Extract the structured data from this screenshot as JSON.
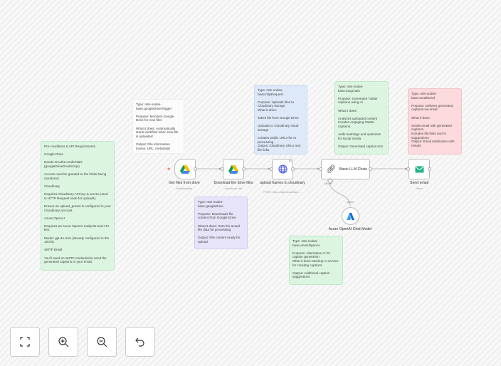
{
  "notes": {
    "prereq": "Pre-conditions & API Requirements\n\nGoogle Drive\n\nNeeds OAuth2 credentials (googleDriveOAuth2Api)\n\nAccess must be granted to the folder being monitored.\n\nCloudinary\n\nRequires Cloudinary API key & secret (used in HTTP Request node for uploads).\n\nEnsure an upload_preset is configured in your Cloudinary account.\n\nAzure OpenAI\n\nRequires an Azure OpenAI endpoint and API key.\n\nModel: gpt-4o-mini (already configured in the JSON).\n\nSMTP Email\n\nYou'll need an SMTP credential to send the generated captions to your email.",
    "trigger": "Type: n8n-nodes-base.googleDriveTrigger\n\nPurpose: Monitors Google Drive for new files\n\nWhat it does: Automatically starts workflow when new file is uploaded\n\nOutput: File information (name, URL, metadata)",
    "http": "Type: n8n-nodes-base.httpRequest\n\nPurpose: Uploads files to Cloudinary storage\nWhat it does:\n\nTakes file from Google Drive\n\nUploads to Cloudinary cloud storage\n\nCreates public URLs for AI processing\nOutput: Cloudinary URLs and file links",
    "langchain": "Type: n8n-nodes-base.langchain\n\nPurpose: Generates Twitter captions using AI\n\nWhat it does:\n\nAnalyzes uploaded content\nCreates engaging Twitter captions\n\nAdds hashtags and optimizes for social media\n\nOutput: Generated caption text",
    "email": "Type: n8n-nodes-base.emailSend\n\nPurpose: Delivers generated captions via email\n\nWhat it does:\n\nSends email with generated captions\nIncludes file links and AI suggestions\nOutput: Email notification with results",
    "drive": "Type: n8n-nodes-base.googleDrive\n\nPurpose: Downloads file content from Google Drive\n\nWhat it does: Gets the actual file data for processing\n\nOutput: File content ready for upload",
    "azure": "Type: n8n-nodes-base.azureOpenAI\n\nPurpose: Alternative AI for caption generation\nWhat it does: Backup AI service for creating captions\n\nOutput: Additional caption suggestions"
  },
  "nodes": {
    "trigger": {
      "label": "Get files from drive",
      "sub": "fileUploaded"
    },
    "download": {
      "label": "Download the drive files",
      "sub": "download: file"
    },
    "http": {
      "label": "upload frames to cloudinary",
      "sub": "POST: https://api.cloudinary...."
    },
    "llm": {
      "label": "Basic LLM Chain",
      "port": "Model"
    },
    "email": {
      "label": "Send email",
      "sub": "Send"
    },
    "azure": {
      "label": "Azure OpenAI Chat Model",
      "port": "Model"
    }
  },
  "colors": {
    "drive_blue": "#4285f4",
    "globe": "#3b4ee8",
    "email": "#21b48a",
    "azure": "#0a6ed1"
  },
  "controls": [
    "fit-view",
    "zoom-in",
    "zoom-out",
    "undo"
  ]
}
